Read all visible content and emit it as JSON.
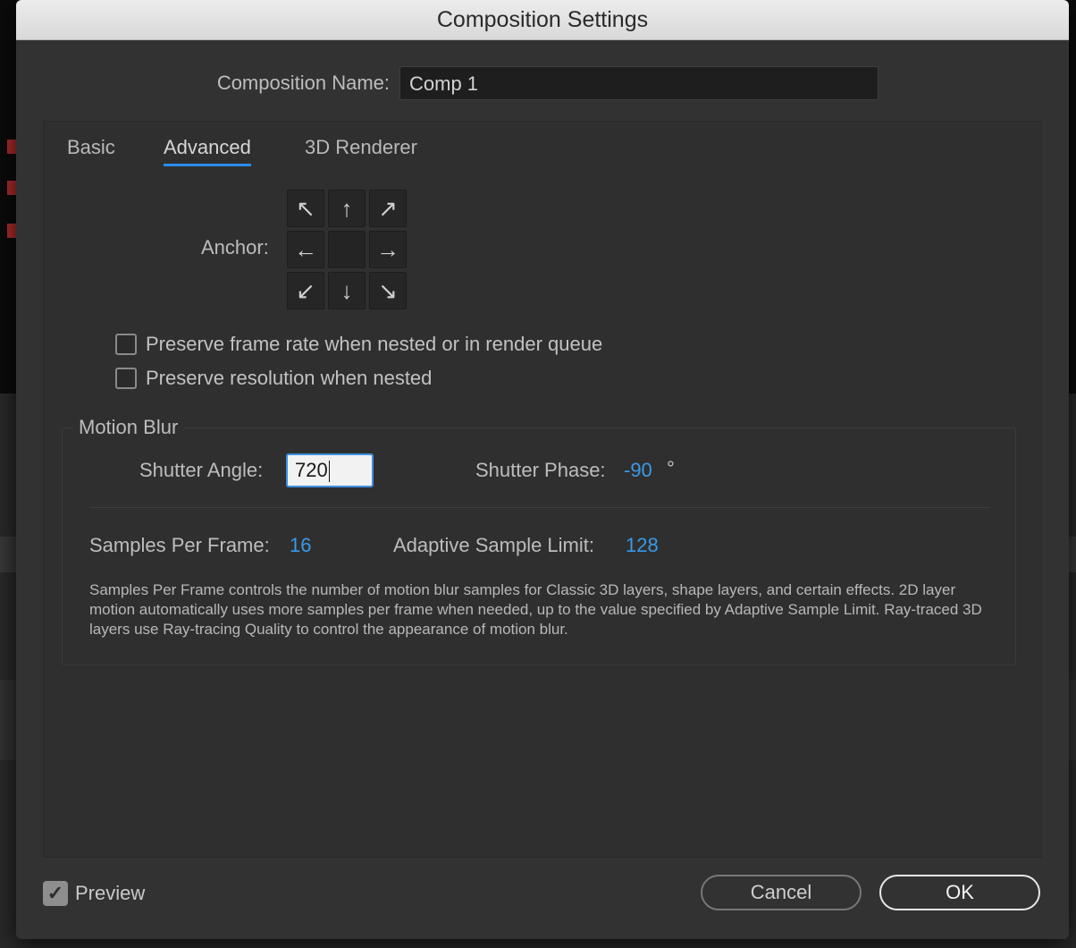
{
  "window": {
    "title": "Composition Settings"
  },
  "composition": {
    "name_label": "Composition Name:",
    "name_value": "Comp 1"
  },
  "tabs": [
    {
      "label": "Basic",
      "active": false
    },
    {
      "label": "Advanced",
      "active": true
    },
    {
      "label": "3D Renderer",
      "active": false
    }
  ],
  "anchor": {
    "label": "Anchor:",
    "cells": [
      "↖",
      "↑",
      "↗",
      "←",
      "",
      "→",
      "↙",
      "↓",
      "↘"
    ],
    "icons": [
      "arrow-up-left-icon",
      "arrow-up-icon",
      "arrow-up-right-icon",
      "arrow-left-icon",
      "center-icon",
      "arrow-right-icon",
      "arrow-down-left-icon",
      "arrow-down-icon",
      "arrow-down-right-icon"
    ]
  },
  "options": {
    "preserve_frame_rate": {
      "label": "Preserve frame rate when nested or in render queue",
      "checked": false
    },
    "preserve_resolution": {
      "label": "Preserve resolution when nested",
      "checked": false
    }
  },
  "motion_blur": {
    "title": "Motion Blur",
    "shutter_angle_label": "Shutter Angle:",
    "shutter_angle_value": "720",
    "shutter_phase_label": "Shutter Phase:",
    "shutter_phase_value": "-90",
    "shutter_phase_unit": "°",
    "samples_label": "Samples Per Frame:",
    "samples_value": "16",
    "adaptive_label": "Adaptive Sample Limit:",
    "adaptive_value": "128",
    "description": "Samples Per Frame controls the number of motion blur samples for Classic 3D layers, shape layers, and certain effects. 2D layer motion automatically uses more samples per frame when needed, up to the value specified by Adaptive Sample Limit. Ray-traced 3D layers use Ray-tracing Quality to control the appearance of motion blur."
  },
  "footer": {
    "preview_label": "Preview",
    "preview_checked": true,
    "cancel_label": "Cancel",
    "ok_label": "OK"
  },
  "colors": {
    "accent": "#2d8ceb",
    "value_blue": "#3a9ae8",
    "dialog_bg": "#323232"
  }
}
